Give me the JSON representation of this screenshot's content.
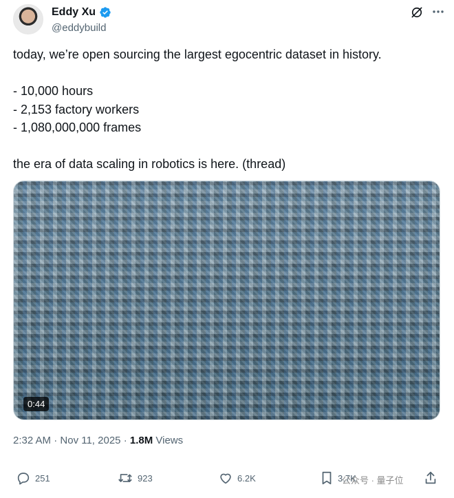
{
  "author": {
    "name": "Eddy Xu",
    "handle": "@eddybuild"
  },
  "tweet": {
    "lines": [
      "today, we’re open sourcing the largest egocentric dataset in history.",
      "",
      "- 10,000 hours",
      "- 2,153 factory workers",
      "- 1,080,000,000 frames",
      "",
      "the era of data scaling in robotics is here. (thread)"
    ]
  },
  "media": {
    "duration": "0:44"
  },
  "meta": {
    "time": "2:32 AM",
    "separator": "·",
    "date": "Nov 11, 2025",
    "views_count": "1.8M",
    "views_label": "Views"
  },
  "actions": {
    "replies": "251",
    "retweets": "923",
    "likes": "6.2K",
    "bookmarks": "3.7K"
  },
  "watermark": "公众号 · 量子位",
  "icons": [
    "verified-icon",
    "grok-icon",
    "more-icon",
    "reply-icon",
    "retweet-icon",
    "like-icon",
    "bookmark-icon",
    "share-icon"
  ],
  "colors": {
    "verified": "#1d9bf0",
    "text": "#0f1419",
    "secondary": "#536471"
  }
}
